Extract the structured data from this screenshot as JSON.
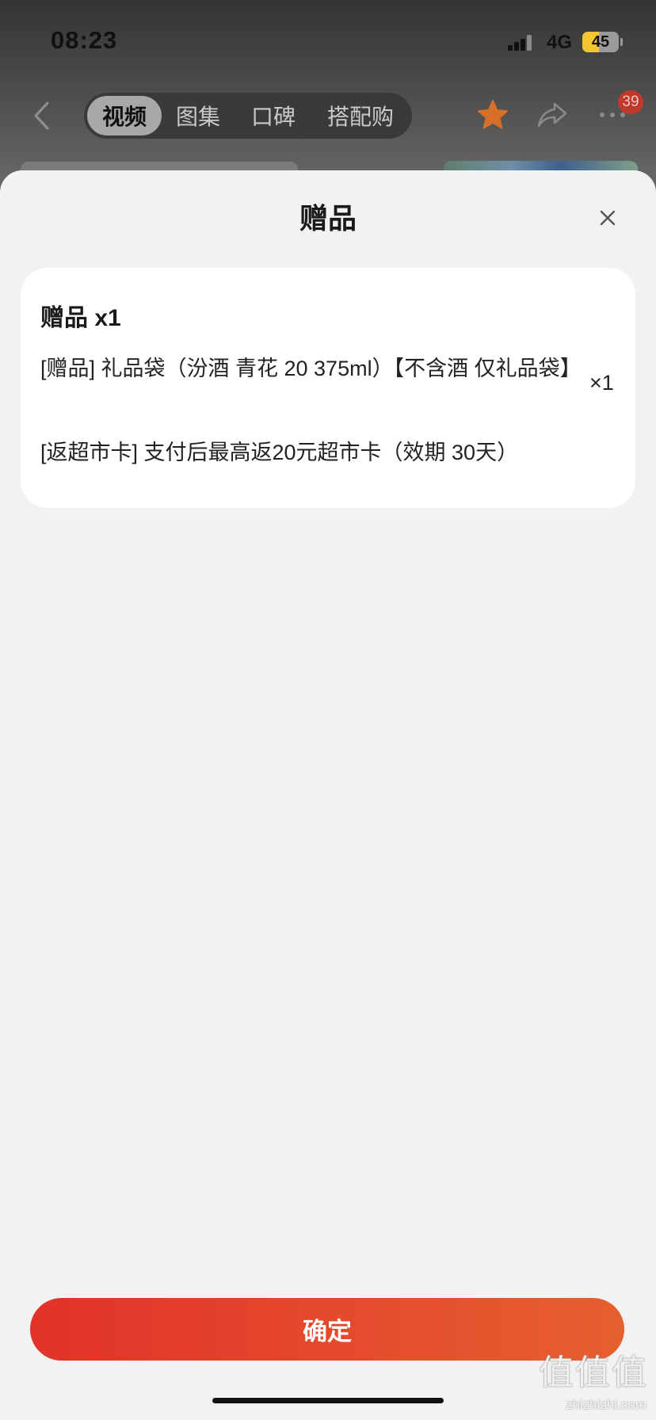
{
  "status_bar": {
    "time": "08:23",
    "network": "4G",
    "battery": 45,
    "signal_icon": "cellular-signal-icon",
    "battery_icon": "battery-icon"
  },
  "top_nav": {
    "back_icon": "chevron-left-icon",
    "tabs": [
      {
        "label": "视频",
        "selected": true
      },
      {
        "label": "图集",
        "selected": false
      },
      {
        "label": "口碑",
        "selected": false
      },
      {
        "label": "搭配购",
        "selected": false
      }
    ],
    "favorite_icon": "star-icon",
    "share_icon": "share-icon",
    "more_icon": "more-dots-icon",
    "more_badge": "39"
  },
  "sheet": {
    "title": "赠品",
    "close_icon": "close-icon",
    "card": {
      "heading": "赠品 x1",
      "items": [
        {
          "text": "[赠品] 礼品袋（汾酒 青花 20 375ml）【不含酒 仅礼品袋】",
          "quantity": "×1"
        },
        {
          "text": "[返超市卡] 支付后最高返20元超市卡（效期 30天）"
        }
      ]
    },
    "confirm_label": "确定"
  },
  "watermark": {
    "logo": "值值值",
    "site": "zhizhizhi.com"
  },
  "colors": {
    "accent_start": "#e2322a",
    "accent_end": "#e6602f",
    "battery": "#f4c431",
    "badge": "#c0392b",
    "star": "#d66f28",
    "sheet_bg": "#f2f2f2",
    "card_bg": "#ffffff"
  }
}
